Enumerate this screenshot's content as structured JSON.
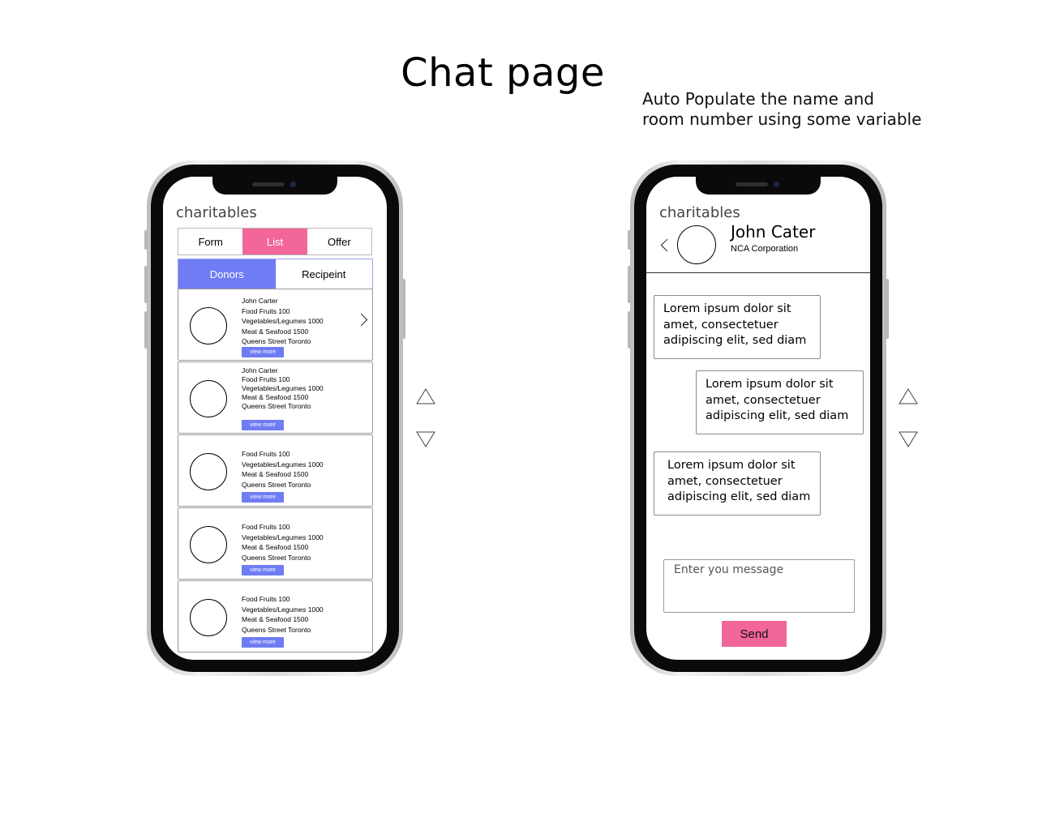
{
  "page": {
    "title": "Chat page",
    "note_line1": "Auto Populate the name and",
    "note_line2": "room number using some variable"
  },
  "list_phone": {
    "app_title": "charitables",
    "top_tabs": [
      {
        "label": "Form",
        "active": false
      },
      {
        "label": "List",
        "active": true
      },
      {
        "label": "Offer",
        "active": false
      }
    ],
    "sub_tabs": [
      {
        "label": "Donors",
        "active": true
      },
      {
        "label": "Recipeint",
        "active": false
      }
    ],
    "cards": [
      {
        "lines": [
          "John Carter",
          "Food Fruits 100",
          "Vegetables/Legumes 1000",
          "Meat & Seafood 1500",
          "Queens Street Toronto"
        ],
        "button": "view more"
      },
      {
        "lines": [
          "John Carter",
          "Food Fruits 100",
          "Vegetables/Legumes 1000",
          "Meat & Seafood 1500",
          "Queens Street Toronto"
        ],
        "button": "view more"
      },
      {
        "lines": [
          "Food Fruits 100",
          "Vegetables/Legumes 1000",
          "Meat & Seafood 1500",
          "Queens Street Toronto"
        ],
        "button": "view more"
      },
      {
        "lines": [
          "Food Fruits 100",
          "Vegetables/Legumes 1000",
          "Meat & Seafood 1500",
          "Queens Street Toronto"
        ],
        "button": "view more"
      },
      {
        "lines": [
          "Food Fruits 100",
          "Vegetables/Legumes 1000",
          "Meat & Seafood 1500",
          "Queens Street Toronto"
        ],
        "button": "view more"
      }
    ]
  },
  "chat_phone": {
    "app_title": "charitables",
    "contact_name": "John Cater",
    "contact_org": "NCA Corporation",
    "messages": [
      {
        "text": "Lorem ipsum dolor sit amet, consectetuer adipiscing elit, sed diam"
      },
      {
        "text": "Lorem ipsum dolor sit amet, consectetuer adipiscing elit, sed diam"
      },
      {
        "text": "Lorem ipsum dolor sit amet, consectetuer adipiscing elit, sed diam"
      }
    ],
    "input_placeholder": "Enter you message",
    "send_label": "Send"
  },
  "colors": {
    "pink": "#f2669a",
    "blue": "#6f7cf3"
  },
  "icons": [
    "chevron-right-icon",
    "chevron-left-icon",
    "scroll-up-arrow-icon",
    "scroll-down-arrow-icon"
  ]
}
